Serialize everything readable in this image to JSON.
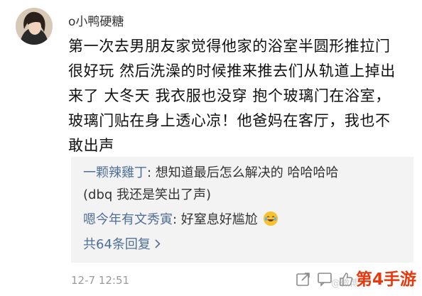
{
  "post": {
    "username": "o小鸭硬糖",
    "text_lines": [
      "第一次去男朋友家觉得他家的浴室半圆形推拉门",
      "很好玩 然后洗澡的时候推来推去们从轨道上掉出",
      "来了 大冬天 我衣服也没穿 抱个玻璃门在浴室，",
      "玻璃门贴在身上透心凉！他爸妈在客厅，我也不",
      "敢出声"
    ],
    "timestamp": "12-7 12:51"
  },
  "replies": [
    {
      "user": "一颗辣雞丁",
      "text": ": 想知道最后怎么解决的 哈哈哈哈"
    },
    {
      "user": "",
      "text": "(dbq 我还是笑出了声)"
    },
    {
      "user": "嗯今年有文秀寅",
      "text": ": 好窒息好尴尬",
      "emoji": "laughing-tears-emoji"
    }
  ],
  "more_replies": "共64条回复",
  "actions": [
    {
      "icon": "share-icon"
    },
    {
      "icon": "comment-icon"
    },
    {
      "icon": "like-icon"
    }
  ],
  "watermark": "@微博",
  "logo": "第4手游",
  "colors": {
    "reply_user": "#4f6f96",
    "reply_bg": "#f3f3f3",
    "logo": "#e8380d",
    "timestamp": "#9a9a9a"
  }
}
